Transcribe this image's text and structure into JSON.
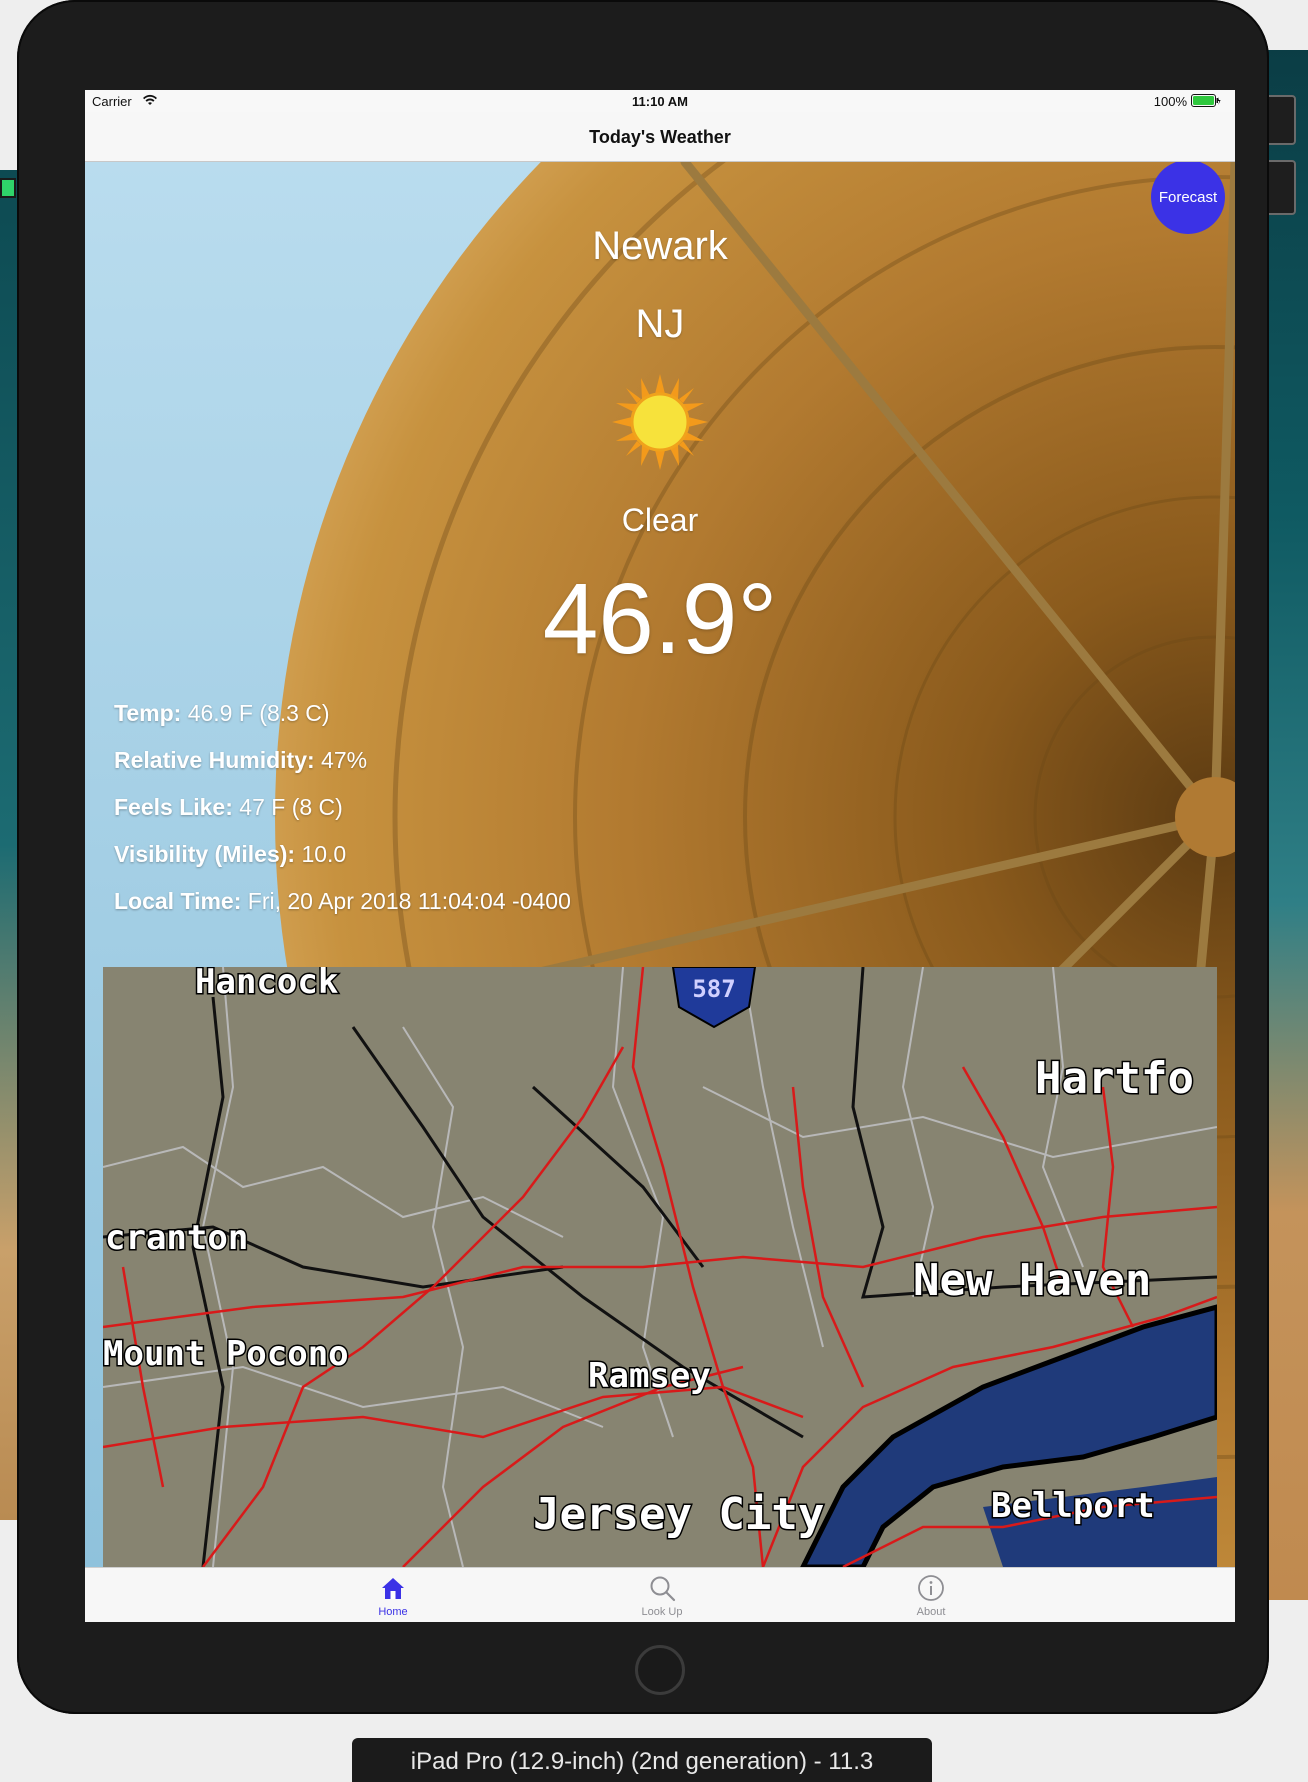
{
  "status_bar": {
    "carrier": "Carrier",
    "time": "11:10 AM",
    "battery": "100%"
  },
  "nav": {
    "title": "Today's Weather"
  },
  "forecast_button": "Forecast",
  "weather": {
    "city": "Newark",
    "state": "NJ",
    "condition": "Clear",
    "temperature": "46.9°",
    "icon": "sun-icon"
  },
  "details": [
    {
      "label": "Temp:",
      "value": "46.9 F (8.3 C)"
    },
    {
      "label": "Relative Humidity:",
      "value": "47%"
    },
    {
      "label": "Feels Like:",
      "value": "47 F (8 C)"
    },
    {
      "label": "Visibility (Miles):",
      "value": "10.0"
    },
    {
      "label": "Local Time:",
      "value": "Fri, 20 Apr 2018 11:04:04 -0400"
    }
  ],
  "radar_map": {
    "labels": {
      "hancock": "Hancock",
      "route": "587",
      "hartford": "Hartfo",
      "scranton": "cranton",
      "new_haven": "New Haven",
      "mount_pocono": "Mount Pocono",
      "ramsey": "Ramsey",
      "jersey_city": "Jersey City",
      "bellport": "Bellport"
    }
  },
  "tabs": [
    {
      "label": "Home",
      "icon": "home-icon",
      "active": true
    },
    {
      "label": "Look Up",
      "icon": "search-icon",
      "active": false
    },
    {
      "label": "About",
      "icon": "info-icon",
      "active": false
    }
  ],
  "simulator_caption": "iPad Pro (12.9-inch) (2nd generation) - 11.3",
  "colors": {
    "accent": "#3b32e6",
    "map_land": "#878471",
    "map_water": "#1f3a7a",
    "map_roads": "#d81a1a"
  }
}
